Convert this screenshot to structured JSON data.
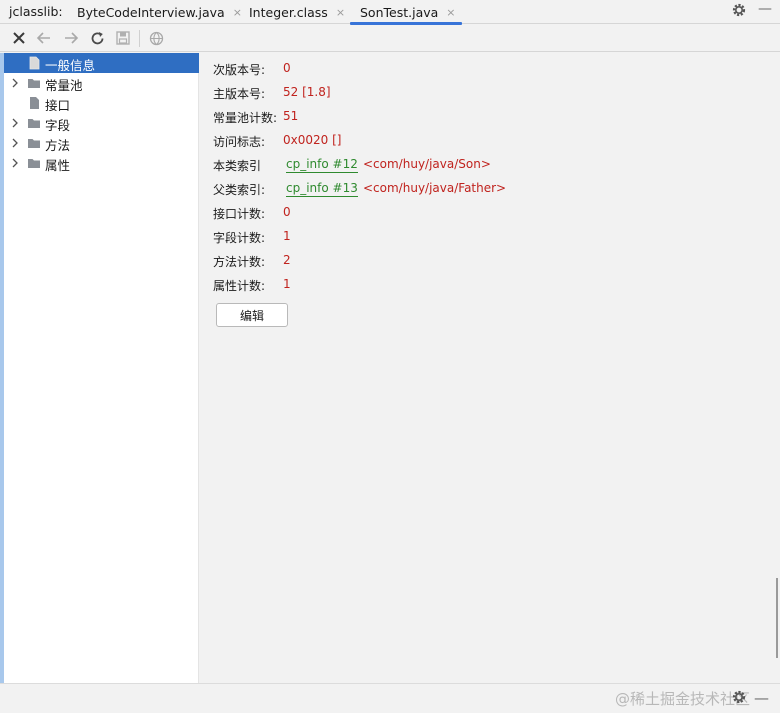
{
  "tabbar": {
    "app_label": "jclasslib:",
    "tabs": [
      {
        "label": "ByteCodeInterview.java",
        "close": "×"
      },
      {
        "label": "Integer.class",
        "close": "×"
      },
      {
        "label": "SonTest.java",
        "close": "×"
      }
    ],
    "more": "—"
  },
  "toolbar": {
    "icons": [
      "close-icon",
      "back-arrow-icon",
      "forward-arrow-icon",
      "refresh-icon",
      "save-icon",
      "browser-icon"
    ]
  },
  "tree": {
    "items": [
      {
        "label": "一般信息",
        "icon": "file-icon",
        "selected": true
      },
      {
        "label": "常量池",
        "icon": "folder-icon"
      },
      {
        "label": "接口",
        "icon": "file-icon"
      },
      {
        "label": "字段",
        "icon": "folder-icon"
      },
      {
        "label": "方法",
        "icon": "folder-icon"
      },
      {
        "label": "属性",
        "icon": "folder-icon"
      }
    ]
  },
  "details": {
    "minor_version": {
      "label": "次版本号:",
      "value": "0"
    },
    "major_version": {
      "label": "主版本号:",
      "value": "52 [1.8]"
    },
    "constant_pool_count": {
      "label": "常量池计数:",
      "value": "51"
    },
    "access_flags": {
      "label": "访问标志:",
      "value": "0x0020 []"
    },
    "this_class": {
      "label": "本类索引",
      "link": "cp_info #12",
      "value": "<com/huy/java/Son>"
    },
    "super_class": {
      "label": "父类索引:",
      "link": "cp_info #13",
      "value": "<com/huy/java/Father>"
    },
    "interfaces_count": {
      "label": "接口计数:",
      "value": "0"
    },
    "fields_count": {
      "label": "字段计数:",
      "value": "1"
    },
    "methods_count": {
      "label": "方法计数:",
      "value": "2"
    },
    "attributes_count": {
      "label": "属性计数:",
      "value": "1"
    },
    "edit_button": "编辑"
  },
  "statusbar": {
    "watermark": "@稀土掘金技术社区"
  },
  "colors": {
    "accent": "#3874d8",
    "selection": "#2f6ec2",
    "value_red": "#c0231e",
    "link_green": "#2f8a2f"
  }
}
